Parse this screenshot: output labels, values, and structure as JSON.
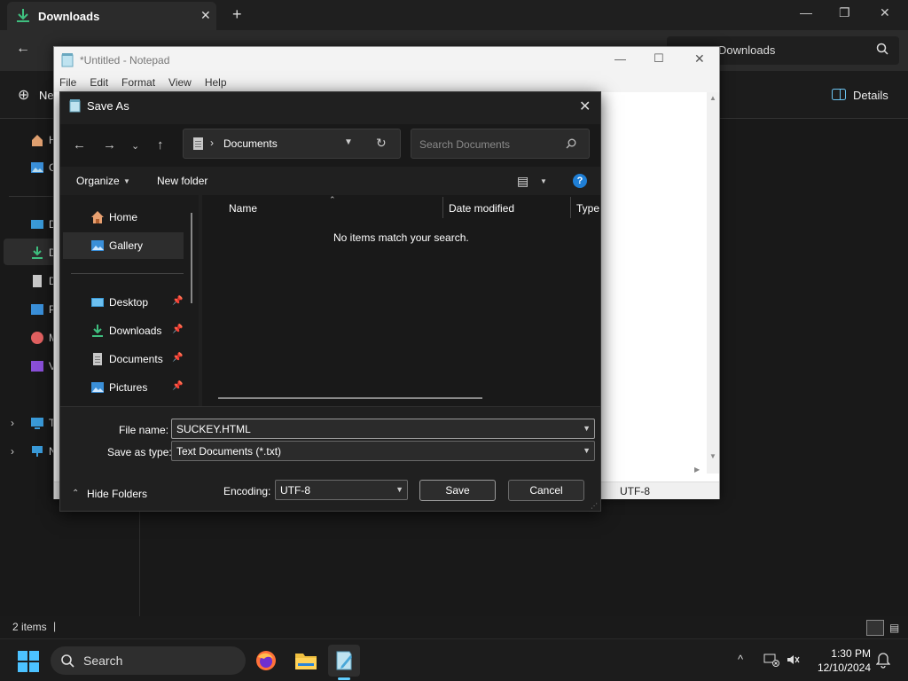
{
  "explorer": {
    "tab_title": "Downloads",
    "new_tab": "+",
    "search_text": "Downloads",
    "new_label": "Ne",
    "details_label": "Details",
    "status_text": "2 items",
    "sidebar_initials": [
      "H",
      "G",
      "D",
      "D",
      "D",
      "P",
      "M",
      "V",
      "T",
      "N"
    ]
  },
  "notepad": {
    "title": "*Untitled - Notepad",
    "menu": [
      "File",
      "Edit",
      "Format",
      "View",
      "Help"
    ],
    "status_encoding": "UTF-8"
  },
  "dialog": {
    "title": "Save As",
    "breadcrumb": "Documents",
    "search_placeholder": "Search Documents",
    "organize_label": "Organize",
    "new_folder_label": "New folder",
    "help_label": "?",
    "nav_items": [
      {
        "label": "Home",
        "icon": "home-icon",
        "pinned": false
      },
      {
        "label": "Gallery",
        "icon": "gallery-icon",
        "pinned": false
      },
      {
        "label": "Desktop",
        "icon": "desktop-icon",
        "pinned": true
      },
      {
        "label": "Downloads",
        "icon": "download-icon",
        "pinned": true
      },
      {
        "label": "Documents",
        "icon": "document-icon",
        "pinned": true
      },
      {
        "label": "Pictures",
        "icon": "pictures-icon",
        "pinned": true
      }
    ],
    "columns": [
      "Name",
      "Date modified",
      "Type"
    ],
    "empty_message": "No items match your search.",
    "file_name_label": "File name:",
    "file_name_value": "SUCKEY.HTML",
    "save_type_label": "Save as type:",
    "save_type_value": "Text Documents (*.txt)",
    "encoding_label": "Encoding:",
    "encoding_value": "UTF-8",
    "save_label": "Save",
    "cancel_label": "Cancel",
    "hide_folders_label": "Hide Folders"
  },
  "taskbar": {
    "search_label": "Search",
    "time": "1:30 PM",
    "date": "12/10/2024"
  },
  "colors": {
    "accent": "#1f7fd6",
    "downloads_green": "#3fbf7f",
    "folder_yellow": "#f0c040"
  }
}
